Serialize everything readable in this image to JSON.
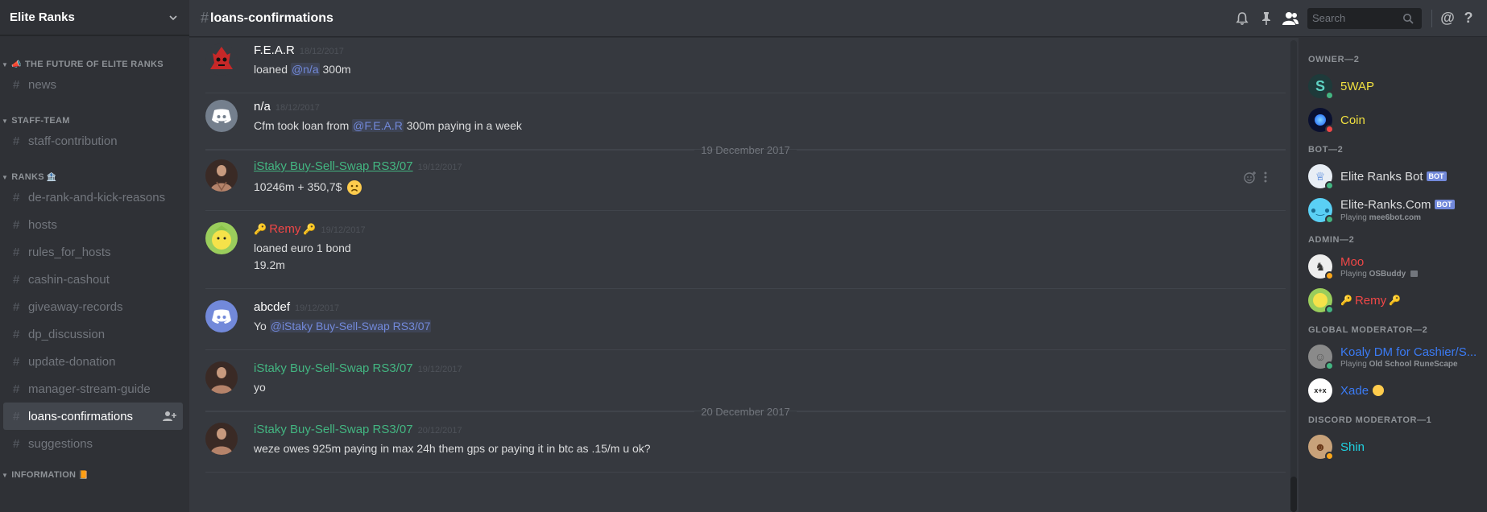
{
  "guild": {
    "name": "Elite Ranks"
  },
  "categories": {
    "future": "THE FUTURE OF ELITE RANKS",
    "staff": "STAFF-TEAM",
    "ranks": "RANKS",
    "information": "INFORMATION"
  },
  "channels": {
    "news": "news",
    "staff_contribution": "staff-contribution",
    "de_rank": "de-rank-and-kick-reasons",
    "hosts": "hosts",
    "rules_for_hosts": "rules_for_hosts",
    "cashin_cashout": "cashin-cashout",
    "giveaway_records": "giveaway-records",
    "dp_discussion": "dp_discussion",
    "update_donation": "update-donation",
    "manager_stream_guide": "manager-stream-guide",
    "loans_confirmations": "loans-confirmations",
    "suggestions": "suggestions"
  },
  "topbar": {
    "channel": "loans-confirmations",
    "search_placeholder": "Search",
    "icons": [
      "bell-icon",
      "pin-icon",
      "members-icon",
      "mention-icon",
      "help-icon"
    ]
  },
  "messages": [
    {
      "author": "F.E.A.R",
      "author_color": "#ffffff",
      "ts": "18/12/2017",
      "pre": "loaned ",
      "mention": "@n/a",
      "post": " 300m"
    },
    {
      "author": "n/a",
      "author_color": "#ffffff",
      "ts": "18/12/2017",
      "pre": "Cfm took loan from ",
      "mention": "@F.E.A.R",
      "post": " 300m paying in a week"
    },
    {
      "author": "iStaky Buy-Sell-Swap RS3/07",
      "author_color": "#43b581",
      "ts": "19/12/2017",
      "text": "10246m + 350,7$"
    },
    {
      "author": "Remy",
      "author_color": "#f04747",
      "ts": "19/12/2017",
      "line1": "loaned euro 1 bond",
      "line2": "19.2m"
    },
    {
      "author": "abcdef",
      "author_color": "#ffffff",
      "ts": "19/12/2017",
      "pre": "Yo ",
      "mention": "@iStaky Buy-Sell-Swap RS3/07"
    },
    {
      "author": "iStaky Buy-Sell-Swap RS3/07",
      "author_color": "#43b581",
      "ts": "19/12/2017",
      "text": "yo"
    },
    {
      "author": "iStaky Buy-Sell-Swap RS3/07",
      "author_color": "#43b581",
      "ts": "20/12/2017",
      "text": "weze owes 925m paying in max 24h them gps or paying it in btc as .15/m  u ok?"
    }
  ],
  "dividers": {
    "d1": "19 December 2017",
    "d2": "20 December 2017"
  },
  "members": {
    "owner_label": "OWNER—2",
    "bot_label": "BOT—2",
    "admin_label": "ADMIN—2",
    "gmod_label": "GLOBAL MODERATOR—2",
    "dmod_label": "DISCORD MODERATOR—1",
    "swap": "5WAP",
    "coin": "Coin",
    "elite_bot": "Elite Ranks Bot",
    "elite_com": "Elite-Ranks.Com",
    "elite_com_activity_prefix": "Playing ",
    "elite_com_activity": "mee6bot.com",
    "moo": "Moo",
    "moo_activity_prefix": "Playing ",
    "moo_activity": "OSBuddy",
    "remy": "Remy",
    "koaly": "Koaly DM for Cashier/S...",
    "koaly_activity_prefix": "Playing ",
    "koaly_activity": "Old School RuneScape",
    "xade": "Xade",
    "shin": "Shin",
    "bot_tag": "BOT"
  },
  "colors": {
    "owner": "#f0e040",
    "admin": "#f04747",
    "gmod": "#3b7bf5",
    "dmod": "#1fd1e0",
    "online": "#43b581",
    "idle": "#faa61a",
    "dnd": "#f04747"
  }
}
